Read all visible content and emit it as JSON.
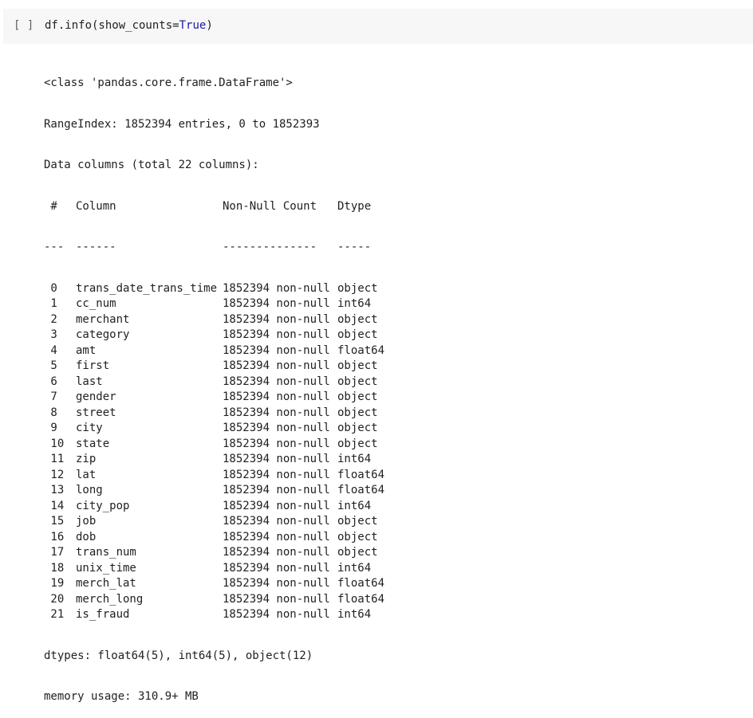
{
  "cell": {
    "run_label": "[ ]",
    "code_prefix": "df.info(show_counts",
    "code_eq": "=",
    "code_true": "True",
    "code_suffix": ")"
  },
  "output": {
    "class_line": "<class 'pandas.core.frame.DataFrame'>",
    "range_line": "RangeIndex: 1852394 entries, 0 to 1852393",
    "data_cols_line": "Data columns (total 22 columns):",
    "header": {
      "idx": " #",
      "name": "Column",
      "count": "Non-Null Count",
      "dtype": "Dtype"
    },
    "separator": {
      "idx": "---",
      "name": "------",
      "count": "--------------",
      "dtype": "-----"
    },
    "rows": [
      {
        "idx": " 0",
        "name": "trans_date_trans_time",
        "count": "1852394 non-null",
        "dtype": "object"
      },
      {
        "idx": " 1",
        "name": "cc_num",
        "count": "1852394 non-null",
        "dtype": "int64"
      },
      {
        "idx": " 2",
        "name": "merchant",
        "count": "1852394 non-null",
        "dtype": "object"
      },
      {
        "idx": " 3",
        "name": "category",
        "count": "1852394 non-null",
        "dtype": "object"
      },
      {
        "idx": " 4",
        "name": "amt",
        "count": "1852394 non-null",
        "dtype": "float64"
      },
      {
        "idx": " 5",
        "name": "first",
        "count": "1852394 non-null",
        "dtype": "object"
      },
      {
        "idx": " 6",
        "name": "last",
        "count": "1852394 non-null",
        "dtype": "object"
      },
      {
        "idx": " 7",
        "name": "gender",
        "count": "1852394 non-null",
        "dtype": "object"
      },
      {
        "idx": " 8",
        "name": "street",
        "count": "1852394 non-null",
        "dtype": "object"
      },
      {
        "idx": " 9",
        "name": "city",
        "count": "1852394 non-null",
        "dtype": "object"
      },
      {
        "idx": " 10",
        "name": "state",
        "count": "1852394 non-null",
        "dtype": "object"
      },
      {
        "idx": " 11",
        "name": "zip",
        "count": "1852394 non-null",
        "dtype": "int64"
      },
      {
        "idx": " 12",
        "name": "lat",
        "count": "1852394 non-null",
        "dtype": "float64"
      },
      {
        "idx": " 13",
        "name": "long",
        "count": "1852394 non-null",
        "dtype": "float64"
      },
      {
        "idx": " 14",
        "name": "city_pop",
        "count": "1852394 non-null",
        "dtype": "int64"
      },
      {
        "idx": " 15",
        "name": "job",
        "count": "1852394 non-null",
        "dtype": "object"
      },
      {
        "idx": " 16",
        "name": "dob",
        "count": "1852394 non-null",
        "dtype": "object"
      },
      {
        "idx": " 17",
        "name": "trans_num",
        "count": "1852394 non-null",
        "dtype": "object"
      },
      {
        "idx": " 18",
        "name": "unix_time",
        "count": "1852394 non-null",
        "dtype": "int64"
      },
      {
        "idx": " 19",
        "name": "merch_lat",
        "count": "1852394 non-null",
        "dtype": "float64"
      },
      {
        "idx": " 20",
        "name": "merch_long",
        "count": "1852394 non-null",
        "dtype": "float64"
      },
      {
        "idx": " 21",
        "name": "is_fraud",
        "count": "1852394 non-null",
        "dtype": "int64"
      }
    ],
    "dtypes_line": "dtypes: float64(5), int64(5), object(12)",
    "memory_line": "memory usage: 310.9+ MB"
  }
}
